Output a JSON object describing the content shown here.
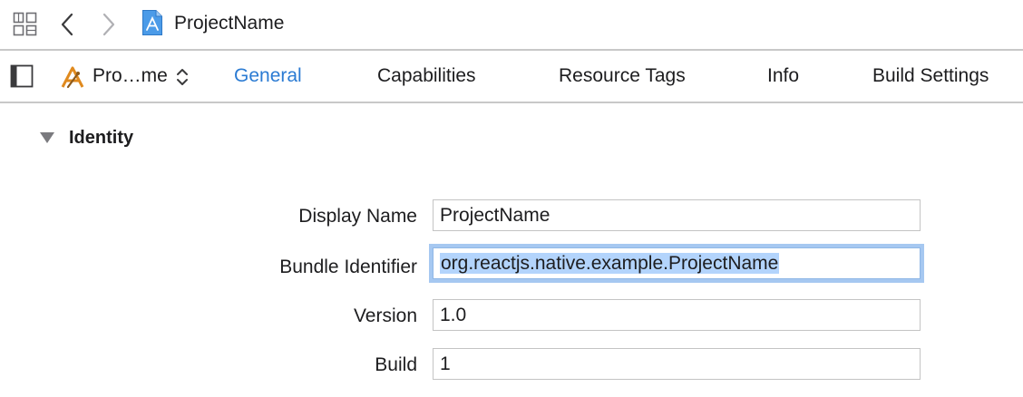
{
  "jumpbar": {
    "title": "ProjectName",
    "icons": [
      "grid-icon",
      "chevron-left-icon",
      "chevron-right-icon",
      "project-file-icon"
    ]
  },
  "tabbar": {
    "target_label": "Pro…me",
    "tabs": [
      {
        "label": "General",
        "active": true
      },
      {
        "label": "Capabilities",
        "active": false
      },
      {
        "label": "Resource Tags",
        "active": false
      },
      {
        "label": "Info",
        "active": false
      },
      {
        "label": "Build Settings",
        "active": false
      }
    ],
    "icons": [
      "sidebar-toggle-icon",
      "app-target-icon",
      "updown-chevron-icon"
    ]
  },
  "identity": {
    "section_title": "Identity",
    "fields": [
      {
        "label": "Display Name",
        "value": "ProjectName"
      },
      {
        "label": "Bundle Identifier",
        "value": "org.reactjs.native.example.ProjectName"
      },
      {
        "label": "Version",
        "value": "1.0"
      },
      {
        "label": "Build",
        "value": "1"
      }
    ]
  },
  "colors": {
    "accent": "#2b7bd3",
    "focus_ring": "#a6c8f1",
    "selection": "#b3d4fc",
    "divider": "#c8c8c8"
  }
}
